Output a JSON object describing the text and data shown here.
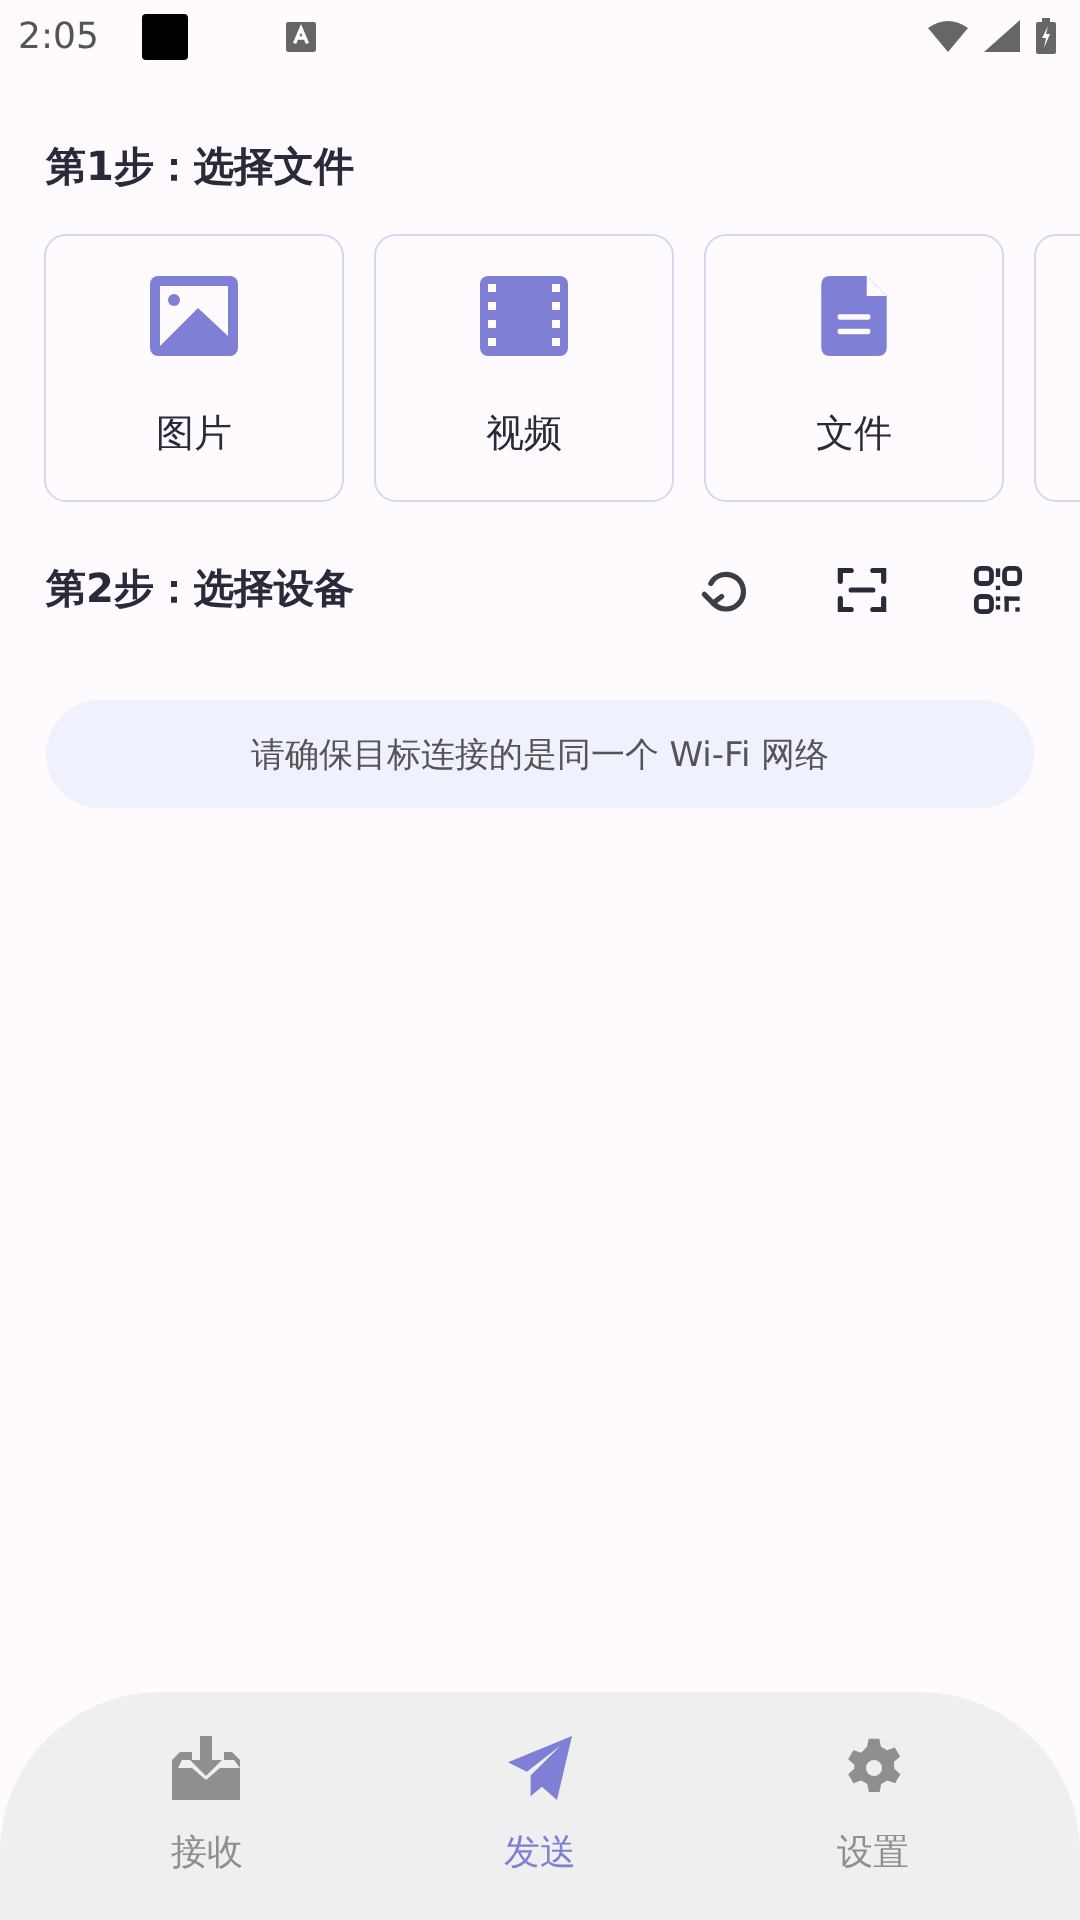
{
  "status_bar": {
    "time": "2:05"
  },
  "step1": {
    "title": "第1步：选择文件",
    "options": [
      {
        "kind": "image",
        "label": "图片"
      },
      {
        "kind": "video",
        "label": "视频"
      },
      {
        "kind": "file",
        "label": "文件"
      },
      {
        "kind": "other"
      }
    ]
  },
  "step2": {
    "title": "第2步：选择设备",
    "notice": "请确保目标连接的是同一个 Wi-Fi 网络"
  },
  "bottom_nav": [
    {
      "kind": "receive",
      "label": "接收",
      "selected": false
    },
    {
      "kind": "send",
      "label": "发送",
      "selected": true
    },
    {
      "kind": "settings",
      "label": "设置",
      "selected": false
    }
  ]
}
